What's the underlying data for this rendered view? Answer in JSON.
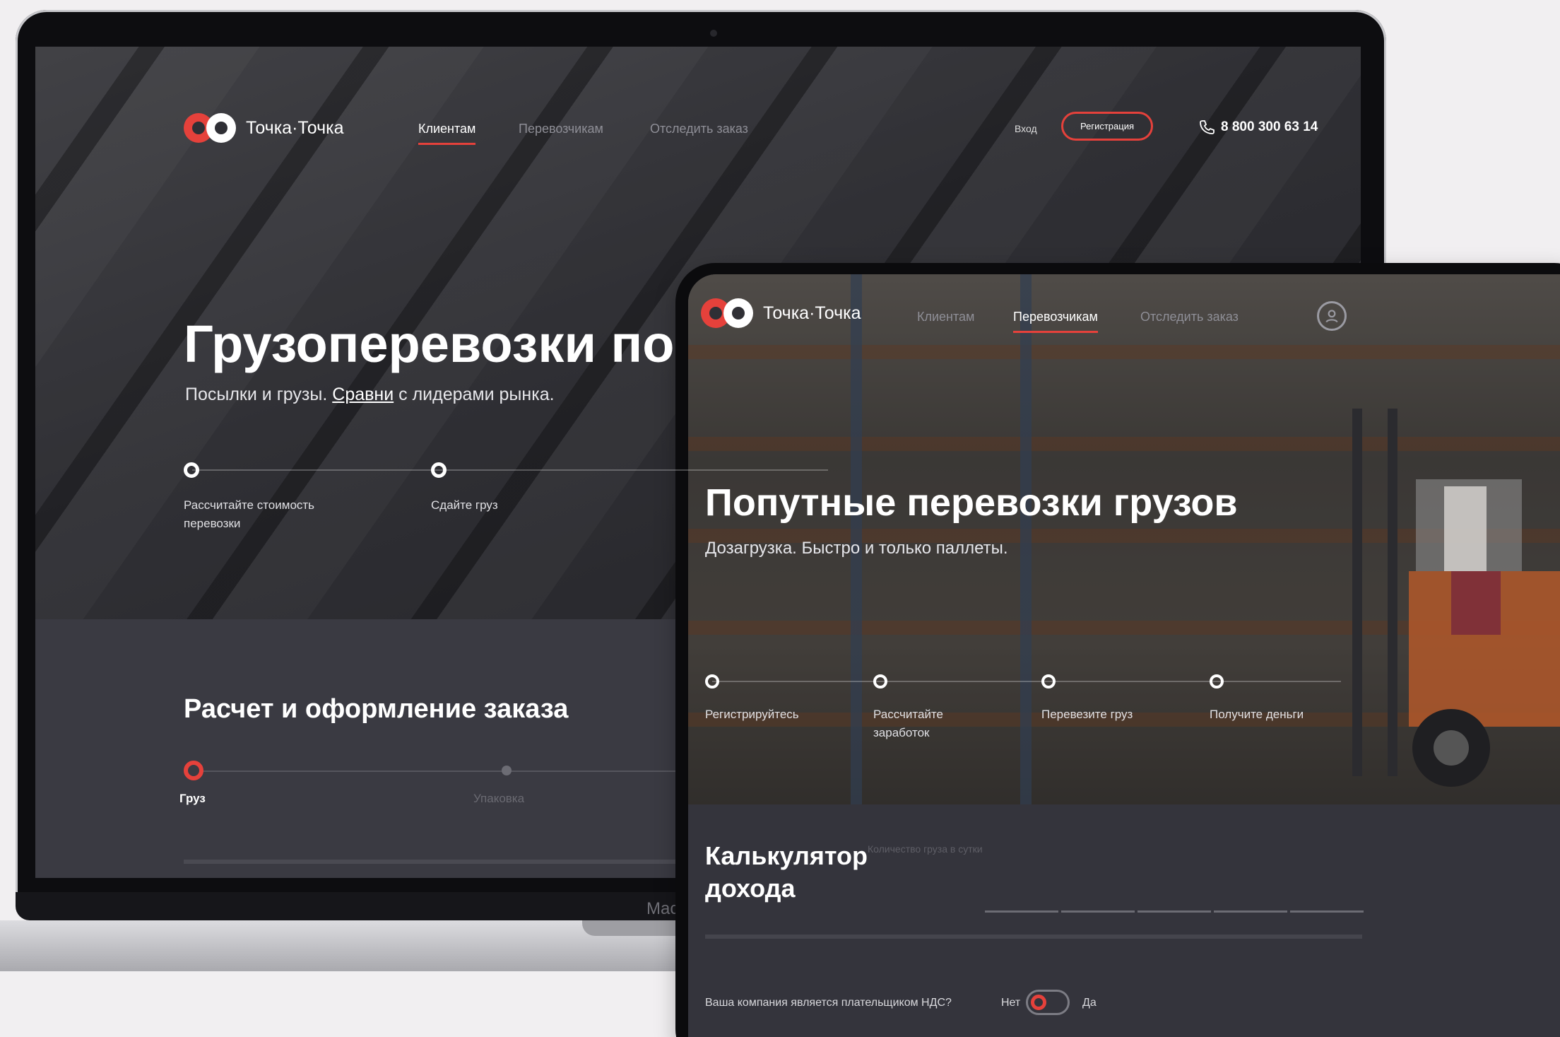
{
  "laptop": {
    "brand": "Точка·Точка",
    "nav": [
      "Клиентам",
      "Перевозчикам",
      "Отследить заказ"
    ],
    "login": "Вход",
    "register": "Регистрация",
    "phone": "8 800 300 63 14",
    "hero_title": "Грузоперевозки по",
    "hero_sub_before": "Посылки и грузы. ",
    "hero_sub_link": "Сравни",
    "hero_sub_after": " с лидерами рынка.",
    "steps": [
      "Рассчитайте стоимость перевозки",
      "Сдайте груз"
    ],
    "order_title": "Расчет и оформление заказа",
    "order_steps": [
      "Груз",
      "Упаковка"
    ],
    "model": "Mac"
  },
  "tablet": {
    "brand": "Точка·Точка",
    "nav": [
      "Клиентам",
      "Перевозчикам",
      "Отследить заказ"
    ],
    "hero_title": "Попутные перевозки грузов",
    "hero_sub": "Дозагрузка. Быстро и только паллеты.",
    "steps": [
      "Регистрируйтесь",
      "Рассчитайте заработок",
      "Перевезите груз",
      "Получите деньги"
    ],
    "calc_title": "Калькулятор дохода",
    "calc_hint": "Количество груза в сутки",
    "vat_question": "Ваша компания является плательщиком НДС?",
    "vat_no": "Нет",
    "vat_yes": "Да"
  },
  "colors": {
    "accent": "#e5413b",
    "dark": "#34343c"
  },
  "icons": [
    "logo-icon",
    "phone-icon",
    "profile-icon"
  ]
}
